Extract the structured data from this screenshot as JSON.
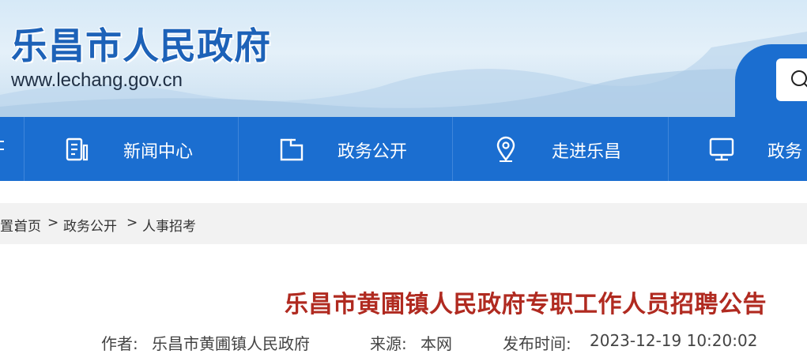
{
  "header": {
    "title": "乐昌市人民政府",
    "url": "www.lechang.gov.cn"
  },
  "search": {
    "icon": "search-icon",
    "placeholder": ""
  },
  "nav": {
    "items": [
      {
        "label": "新闻中心",
        "icon": "news-icon"
      },
      {
        "label": "政务公开",
        "icon": "folder-icon"
      },
      {
        "label": "走进乐昌",
        "icon": "location-pin-icon"
      },
      {
        "label": "政务",
        "icon": "monitor-icon"
      }
    ]
  },
  "breadcrumb": {
    "prefix": "置:",
    "items": [
      "首页",
      "政务公开",
      "人事招考"
    ],
    "separator": ">"
  },
  "article": {
    "title": "乐昌市黄圃镇人民政府专职工作人员招聘公告",
    "author_label": "作者:",
    "author": "乐昌市黄圃镇人民政府",
    "source_label": "来源:",
    "source": "本网",
    "published_label": "发布时间:",
    "published": "2023-12-19 10:20:02"
  },
  "colors": {
    "nav_blue": "#1b6ed0",
    "title_red": "#b02a20",
    "site_title_blue": "#1d62b8"
  }
}
